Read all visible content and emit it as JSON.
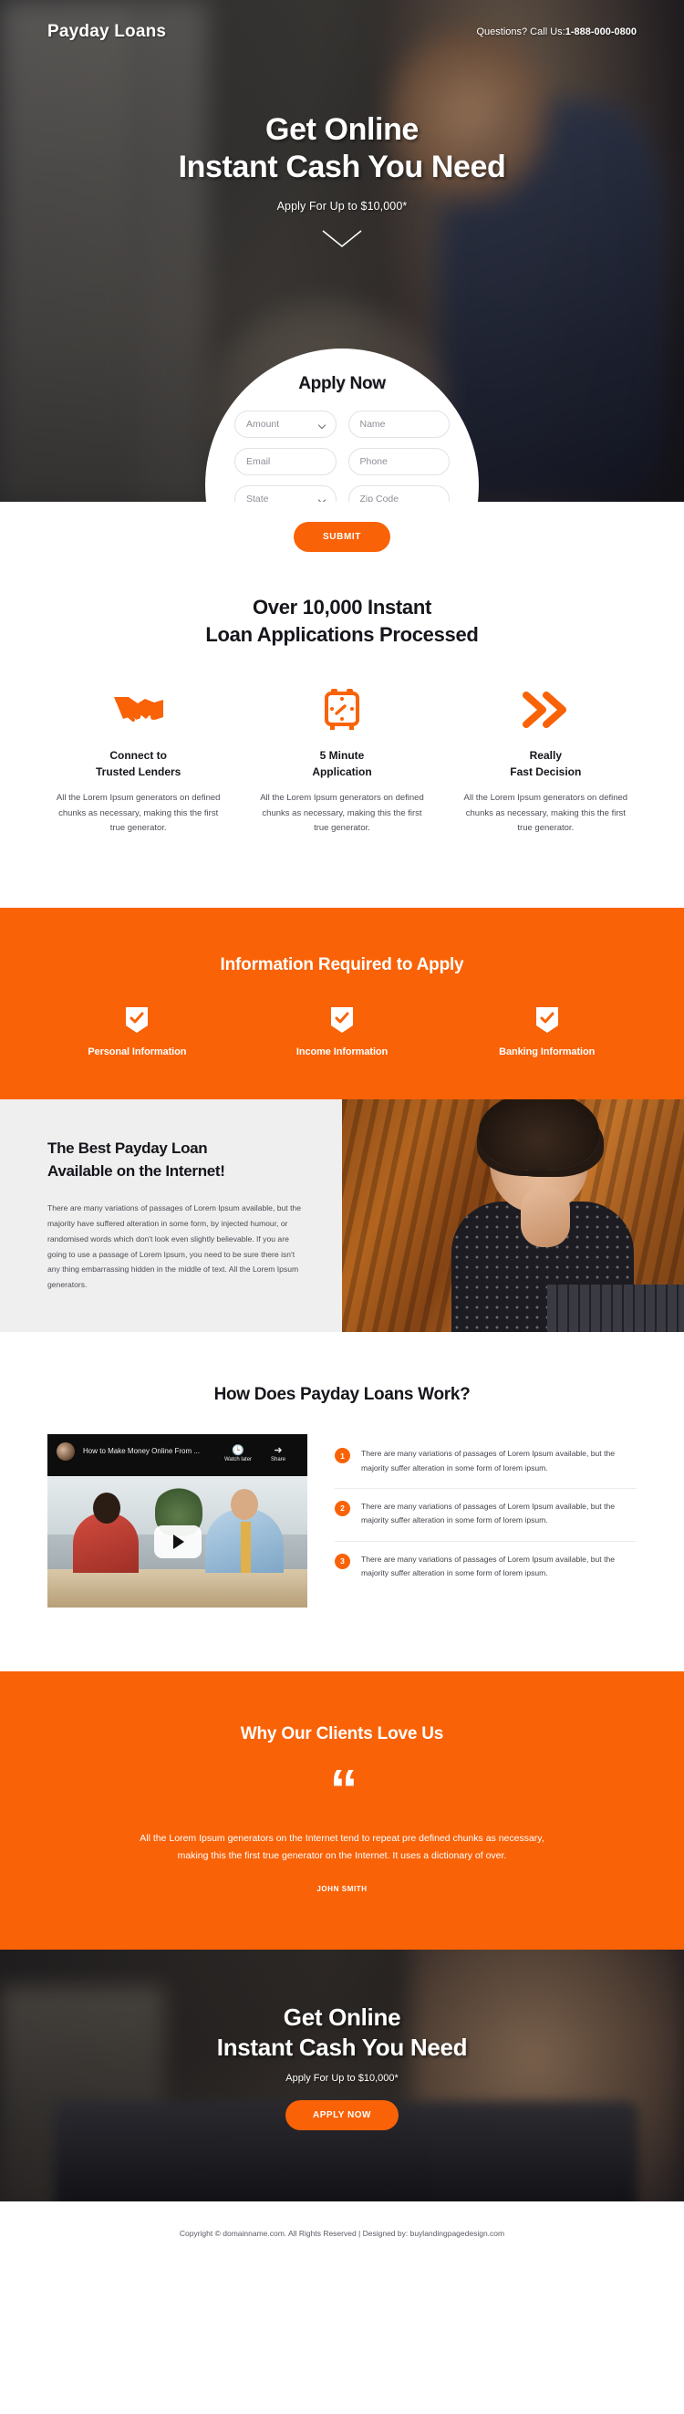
{
  "brand": {
    "name": "Payday Loans"
  },
  "header": {
    "phone_label": "Questions? Call Us:",
    "phone_number": "1-888-000-0800"
  },
  "hero": {
    "title_line1": "Get Online",
    "title_line2": "Instant Cash You Need",
    "subtitle": "Apply For Up to $10,000*",
    "scroll_icon": "chevron-down-icon"
  },
  "form": {
    "title": "Apply Now",
    "fields": [
      {
        "name": "amount",
        "placeholder": "Amount",
        "type": "select"
      },
      {
        "name": "name",
        "placeholder": "Name",
        "type": "text"
      },
      {
        "name": "email",
        "placeholder": "Email",
        "type": "text"
      },
      {
        "name": "phone",
        "placeholder": "Phone",
        "type": "text"
      },
      {
        "name": "state",
        "placeholder": "State",
        "type": "select"
      },
      {
        "name": "zip",
        "placeholder": "Zip Code",
        "type": "text"
      }
    ],
    "submit_label": "SUBMIT"
  },
  "features": {
    "title_line1": "Over 10,000 Instant",
    "title_line2": "Loan Applications Processed",
    "items": [
      {
        "icon": "handshake-icon",
        "title_line1": "Connect to",
        "title_line2": "Trusted Lenders",
        "text": "All the Lorem Ipsum generators on defined chunks as necessary, making this the first true generator."
      },
      {
        "icon": "alarm-clock-icon",
        "title_line1": "5 Minute",
        "title_line2": "Application",
        "text": "All the Lorem Ipsum generators on defined chunks as necessary, making this the first true generator."
      },
      {
        "icon": "double-chevron-right-icon",
        "title_line1": "Really",
        "title_line2": "Fast Decision",
        "text": "All the Lorem Ipsum generators on defined chunks as necessary, making this the first true generator."
      }
    ]
  },
  "info_required": {
    "title": "Information Required to Apply",
    "items": [
      {
        "icon": "shield-check-icon",
        "label": "Personal Information"
      },
      {
        "icon": "shield-check-icon",
        "label": "Income Information"
      },
      {
        "icon": "shield-check-icon",
        "label": "Banking Information"
      }
    ]
  },
  "best": {
    "title_line1": "The Best Payday Loan",
    "title_line2": "Available on the Internet!",
    "text": "There are many variations of passages of Lorem Ipsum available, but the majority have suffered alteration in some form, by injected humour, or randomised words which don't look even slightly believable. If you are going to use a passage of Lorem Ipsum, you need to be sure there isn't any thing embarrassing hidden in the middle of text. All the Lorem Ipsum generators."
  },
  "how": {
    "title": "How Does Payday Loans Work?",
    "video": {
      "title": "How to Make Money Online From ...",
      "watch_later_label": "Watch later",
      "share_label": "Share",
      "watch_later_icon": "clock-icon",
      "share_icon": "share-arrow-icon",
      "play_icon": "play-icon"
    },
    "steps": [
      {
        "num": "1",
        "text": "There are many variations of passages of Lorem Ipsum available, but the majority suffer alteration in some form of lorem ipsum."
      },
      {
        "num": "2",
        "text": "There are many variations of passages of Lorem Ipsum available, but the majority suffer alteration in some form of lorem ipsum."
      },
      {
        "num": "3",
        "text": "There are many variations of passages of Lorem Ipsum available, but the majority suffer alteration in some form of lorem ipsum."
      }
    ]
  },
  "testimonial": {
    "title": "Why Our Clients Love Us",
    "quote_icon": "quotation-mark-icon",
    "quote": "All the Lorem Ipsum generators on the Internet tend to repeat pre defined chunks as necessary, making this the first true generator on the Internet. It uses a dictionary of over.",
    "author": "JOHN SMITH"
  },
  "cta": {
    "title_line1": "Get Online",
    "title_line2": "Instant Cash You Need",
    "subtitle": "Apply For Up to $10,000*",
    "button_label": "APPLY NOW"
  },
  "footer": {
    "copyright": "Copyright © domainname.com. All Rights Reserved | Designed by: buylandingpagedesign.com"
  },
  "colors": {
    "accent": "#f96207",
    "dark": "#15151c",
    "light_gray": "#efefef"
  }
}
